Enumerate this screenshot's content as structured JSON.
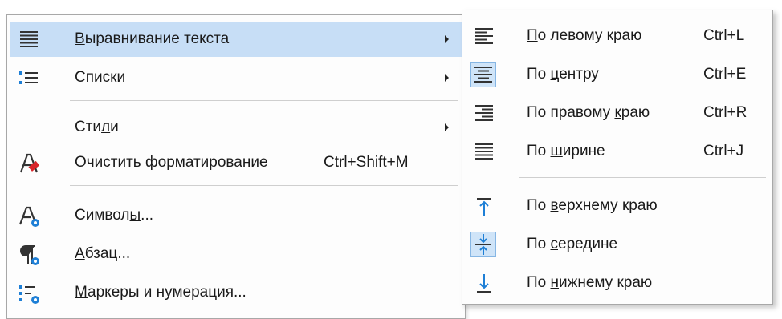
{
  "main_menu": {
    "items": [
      {
        "pre": "",
        "u": "В",
        "post": "ыравнивание текста",
        "shortcut": "",
        "submenu": true,
        "icon": "align-justify-icon"
      },
      {
        "pre": "",
        "u": "С",
        "post": "писки",
        "shortcut": "",
        "submenu": true,
        "icon": "bullet-list-icon"
      },
      {
        "pre": "Сти",
        "u": "л",
        "post": "и",
        "shortcut": "",
        "submenu": true,
        "icon": ""
      },
      {
        "pre": "",
        "u": "О",
        "post": "чистить форматирование",
        "shortcut": "Ctrl+Shift+M",
        "submenu": false,
        "icon": "clear-formatting-icon"
      },
      {
        "pre": "Символ",
        "u": "ы",
        "post": "...",
        "shortcut": "",
        "submenu": false,
        "icon": "character-icon"
      },
      {
        "pre": "",
        "u": "А",
        "post": "бзац...",
        "shortcut": "",
        "submenu": false,
        "icon": "paragraph-icon"
      },
      {
        "pre": "",
        "u": "М",
        "post": "аркеры и нумерация...",
        "shortcut": "",
        "submenu": false,
        "icon": "bullets-numbering-icon"
      }
    ]
  },
  "sub_menu": {
    "items": [
      {
        "pre": "",
        "u": "П",
        "post": "о левому краю",
        "shortcut": "Ctrl+L",
        "icon": "align-left-icon"
      },
      {
        "pre": "По ",
        "u": "ц",
        "post": "ентру",
        "shortcut": "Ctrl+E",
        "icon": "align-center-icon"
      },
      {
        "pre": "По правому ",
        "u": "к",
        "post": "раю",
        "shortcut": "Ctrl+R",
        "icon": "align-right-icon"
      },
      {
        "pre": "По ",
        "u": "ш",
        "post": "ирине",
        "shortcut": "Ctrl+J",
        "icon": "align-justify-icon"
      },
      {
        "pre": "По ",
        "u": "в",
        "post": "ерхнему краю",
        "shortcut": "",
        "icon": "align-top-icon"
      },
      {
        "pre": "По ",
        "u": "с",
        "post": "ередине",
        "shortcut": "",
        "icon": "align-middle-icon"
      },
      {
        "pre": "По ",
        "u": "н",
        "post": "ижнему краю",
        "shortcut": "",
        "icon": "align-bottom-icon"
      }
    ]
  },
  "colors": {
    "highlight": "#c7def6",
    "icon_blue": "#1e7fd6",
    "icon_red": "#d9252a"
  }
}
